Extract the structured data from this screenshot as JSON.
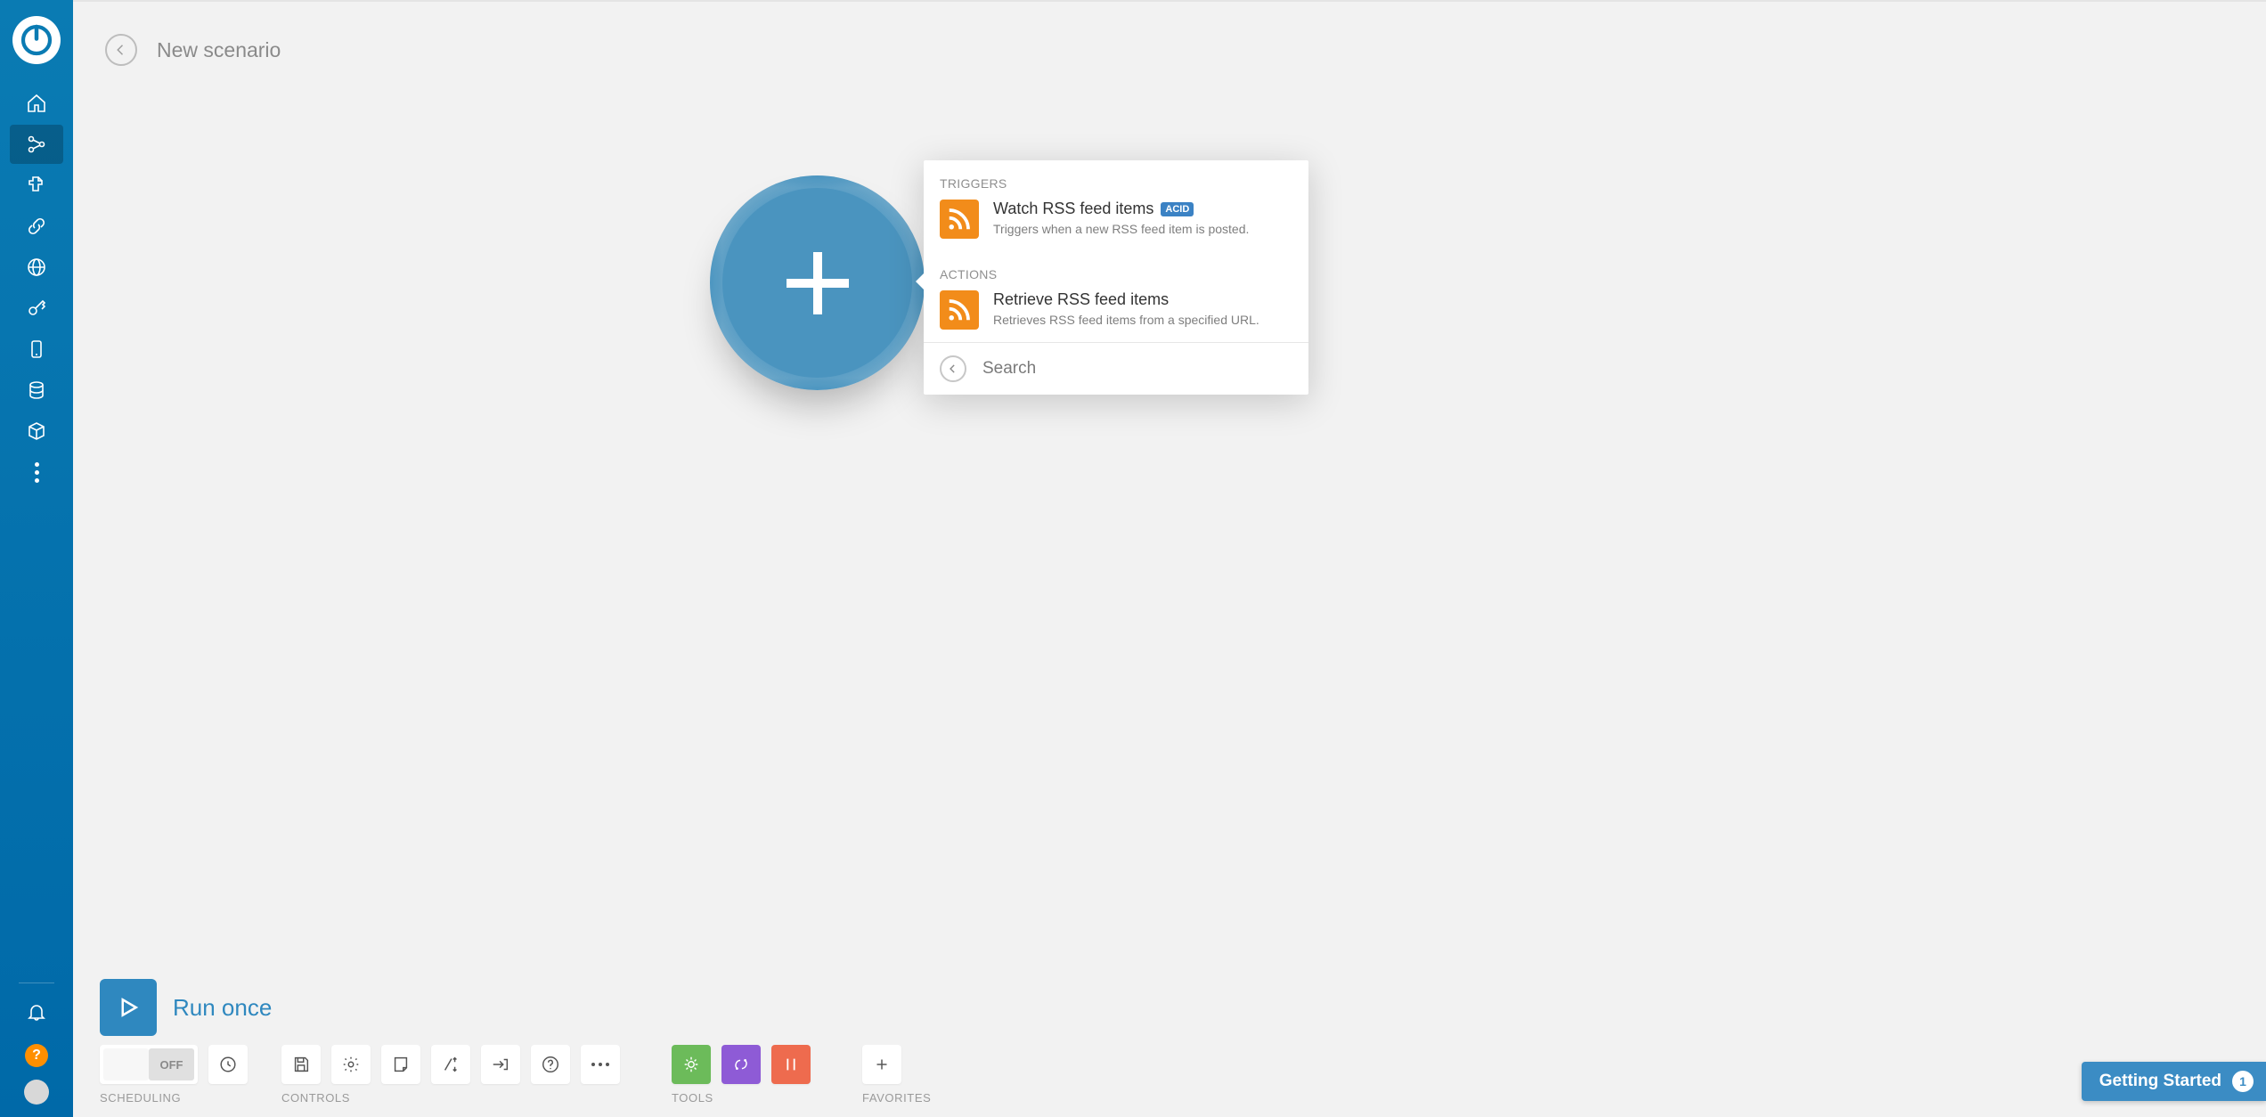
{
  "header": {
    "title": "New scenario"
  },
  "popover": {
    "triggers_label": "TRIGGERS",
    "actions_label": "ACTIONS",
    "triggers": [
      {
        "title": "Watch RSS feed items",
        "badge": "ACID",
        "desc": "Triggers when a new RSS feed item is posted."
      }
    ],
    "actions": [
      {
        "title": "Retrieve RSS feed items",
        "desc": "Retrieves RSS feed items from a specified URL."
      }
    ],
    "search_placeholder": "Search"
  },
  "run": {
    "label": "Run once"
  },
  "scheduling": {
    "label": "SCHEDULING",
    "toggle_state": "OFF"
  },
  "controls": {
    "label": "CONTROLS"
  },
  "tools": {
    "label": "TOOLS"
  },
  "favorites": {
    "label": "FAVORITES"
  },
  "getting_started": {
    "label": "Getting Started",
    "count": "1"
  }
}
